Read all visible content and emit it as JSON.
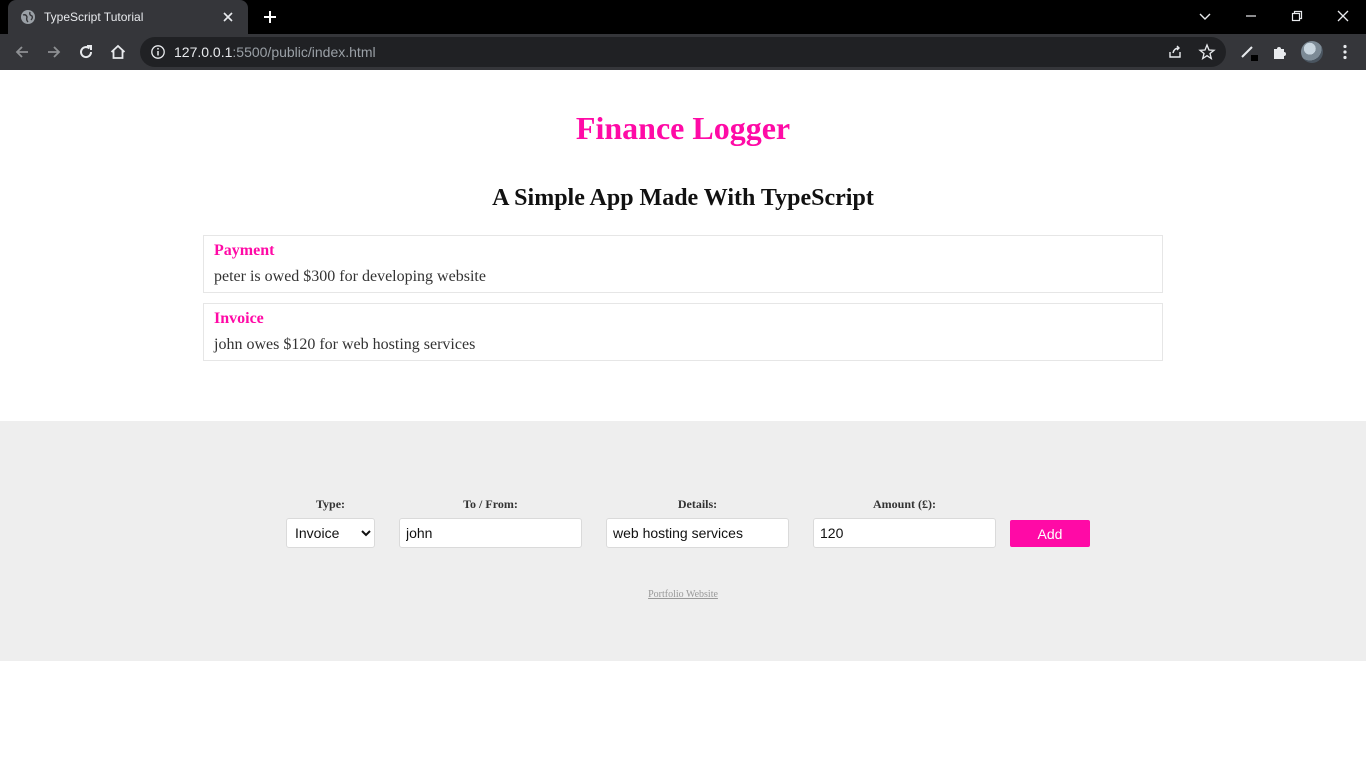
{
  "browser": {
    "tab_title": "TypeScript Tutorial",
    "url_host": "127.0.0.1",
    "url_rest": ":5500/public/index.html"
  },
  "header": {
    "title": "Finance Logger",
    "subtitle": "A Simple App Made With TypeScript"
  },
  "items": [
    {
      "type": "Payment",
      "details": "peter is owed $300 for developing website"
    },
    {
      "type": "Invoice",
      "details": "john owes $120 for web hosting services"
    }
  ],
  "form": {
    "type_label": "Type:",
    "type_value": "Invoice",
    "type_options": [
      "Invoice",
      "Payment"
    ],
    "tofrom_label": "To / From:",
    "tofrom_value": "john",
    "details_label": "Details:",
    "details_value": "web hosting services",
    "amount_label": "Amount (£):",
    "amount_value": "120",
    "add_label": "Add"
  },
  "footer": {
    "link_text": "Portfolio Website"
  },
  "colors": {
    "accent": "#ff0aa6",
    "footer_bg": "#eeeeee",
    "chrome_dark": "#35363a"
  }
}
